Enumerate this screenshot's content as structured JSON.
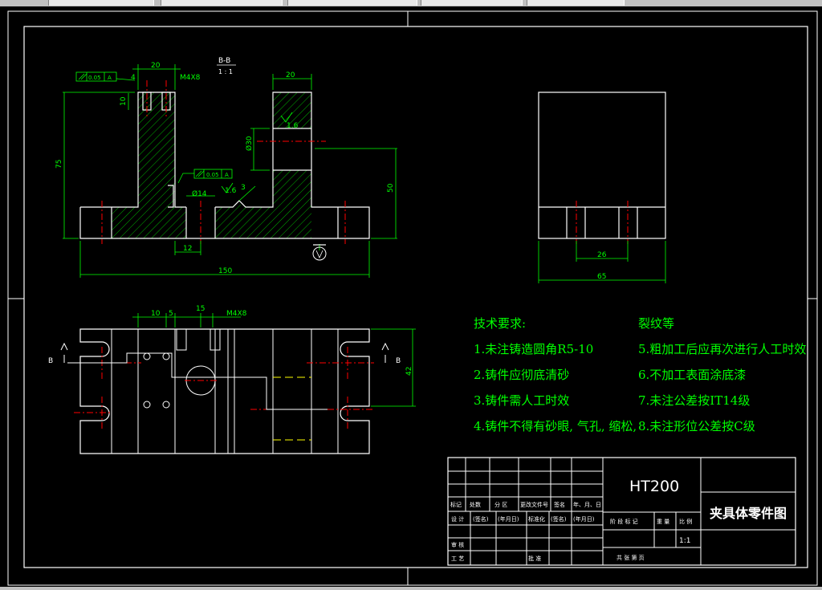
{
  "section_label": {
    "title": "B-B",
    "scale": "1 : 1"
  },
  "dims": {
    "top_width": "20",
    "thread": "M4X8",
    "d4": "4",
    "d10": "10",
    "height_75": "75",
    "right_width": "20",
    "bore": "Ø30",
    "height_50": "50",
    "roughness_16": "1.6",
    "roughness_16b": "1.6",
    "hole_14": "Ø14",
    "d3": "3",
    "d12": "12",
    "total_150": "150",
    "side_26": "26",
    "side_65": "65",
    "plan_10": "10",
    "plan_5": "5",
    "plan_15": "15",
    "plan_thread": "M4X8",
    "plan_42": "42",
    "section_b_left": "B",
    "section_b_right": "B",
    "tol_parallel": "0.05",
    "tol_datum": "A",
    "tol_parallel2": "0.05",
    "tol_datum2": "A"
  },
  "tech_requirements": {
    "heading_left": "技术要求:",
    "heading_right": "裂纹等",
    "items_left": [
      "1.未注铸造圆角R5-10",
      "2.铸件应彻底清砂",
      "3.铸件需人工时效",
      "4.铸件不得有砂眼, 气孔, 缩松,"
    ],
    "items_right": [
      "5.粗加工后应再次进行人工时效",
      "6.不加工表面涂底漆",
      "7.未注公差按IT14级",
      "8.未注形位公差按C级"
    ]
  },
  "title_block": {
    "material": "HT200",
    "part_name": "夹具体零件图",
    "row_labels": [
      "标记",
      "处数",
      "分 区",
      "更改文件号",
      "签名",
      "年、月、日"
    ],
    "design_row": [
      "设 计",
      "(签名)",
      "(年月日)",
      "标准化",
      "(签名)",
      "(年月日)"
    ],
    "stage_labels": [
      "阶 段 标 记",
      "重 量",
      "比 例"
    ],
    "scale_value": "1:1",
    "review": "审 核",
    "process": "工 艺",
    "approve": "批 准",
    "sheets": "共  张  第  页"
  }
}
